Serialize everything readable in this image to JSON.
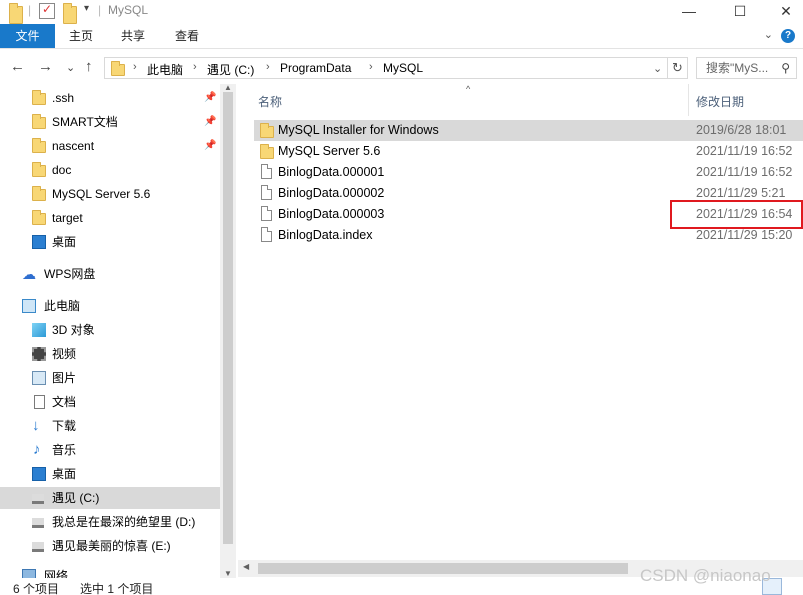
{
  "window": {
    "title": "MySQL",
    "controls": {
      "minimize": "—",
      "maximize": "☐",
      "close": "✕"
    }
  },
  "ribbon": {
    "tabs": [
      "文件",
      "主页",
      "共享",
      "查看"
    ],
    "help": "?",
    "collapse": "⌄"
  },
  "nav": {
    "back": "←",
    "forward": "→",
    "recent": "⌄",
    "up": "↑",
    "breadcrumb": [
      "此电脑",
      "遇见 (C:)",
      "ProgramData",
      "MySQL"
    ],
    "dropdown": "⌄",
    "refresh": "↻",
    "search_placeholder": "搜索\"MyS...",
    "search_icon": "search-icon"
  },
  "sidebar": {
    "quick_access": [
      {
        "label": ".ssh",
        "pinned": true,
        "icon": "folder-icon"
      },
      {
        "label": "SMART文档",
        "pinned": true,
        "icon": "folder-icon"
      },
      {
        "label": "nascent",
        "pinned": true,
        "icon": "folder-icon"
      },
      {
        "label": "doc",
        "pinned": false,
        "icon": "folder-icon"
      },
      {
        "label": "MySQL Server 5.6",
        "pinned": false,
        "icon": "folder-icon"
      },
      {
        "label": "target",
        "pinned": false,
        "icon": "folder-icon"
      },
      {
        "label": "桌面",
        "pinned": false,
        "icon": "desktop-icon"
      }
    ],
    "wps": "WPS网盘",
    "this_pc": "此电脑",
    "pc_items": [
      {
        "label": "3D 对象",
        "icon": "3d-objects-icon"
      },
      {
        "label": "视频",
        "icon": "video-icon"
      },
      {
        "label": "图片",
        "icon": "pictures-icon"
      },
      {
        "label": "文档",
        "icon": "documents-icon"
      },
      {
        "label": "下载",
        "icon": "downloads-icon"
      },
      {
        "label": "音乐",
        "icon": "music-icon"
      },
      {
        "label": "桌面",
        "icon": "desktop-icon"
      },
      {
        "label": "遇见 (C:)",
        "icon": "drive-icon",
        "selected": true
      },
      {
        "label": "我总是在最深的绝望里 (D:)",
        "icon": "drive-icon"
      },
      {
        "label": "遇见最美丽的惊喜 (E:)",
        "icon": "drive-icon"
      }
    ],
    "network": "网络"
  },
  "file_list": {
    "columns": {
      "name": "名称",
      "modified": "修改日期"
    },
    "files": [
      {
        "name": "MySQL Installer for Windows",
        "modified": "2019/6/28 18:01",
        "type": "folder",
        "highlighted": true
      },
      {
        "name": "MySQL Server 5.6",
        "modified": "2021/11/19 16:52",
        "type": "folder"
      },
      {
        "name": "BinlogData.000001",
        "modified": "2021/11/19 16:52",
        "type": "file"
      },
      {
        "name": "BinlogData.000002",
        "modified": "2021/11/29 5:21",
        "type": "file"
      },
      {
        "name": "BinlogData.000003",
        "modified": "2021/11/29 16:54",
        "type": "file"
      },
      {
        "name": "BinlogData.index",
        "modified": "2021/11/29 15:20",
        "type": "file"
      }
    ]
  },
  "status": {
    "count": "6 个项目",
    "selected": "选中 1 个项目"
  },
  "watermark": "CSDN @niaonao",
  "colors": {
    "accent": "#1979ca",
    "highlight_box": "#e0191f",
    "selection": "#d9d9d9"
  }
}
